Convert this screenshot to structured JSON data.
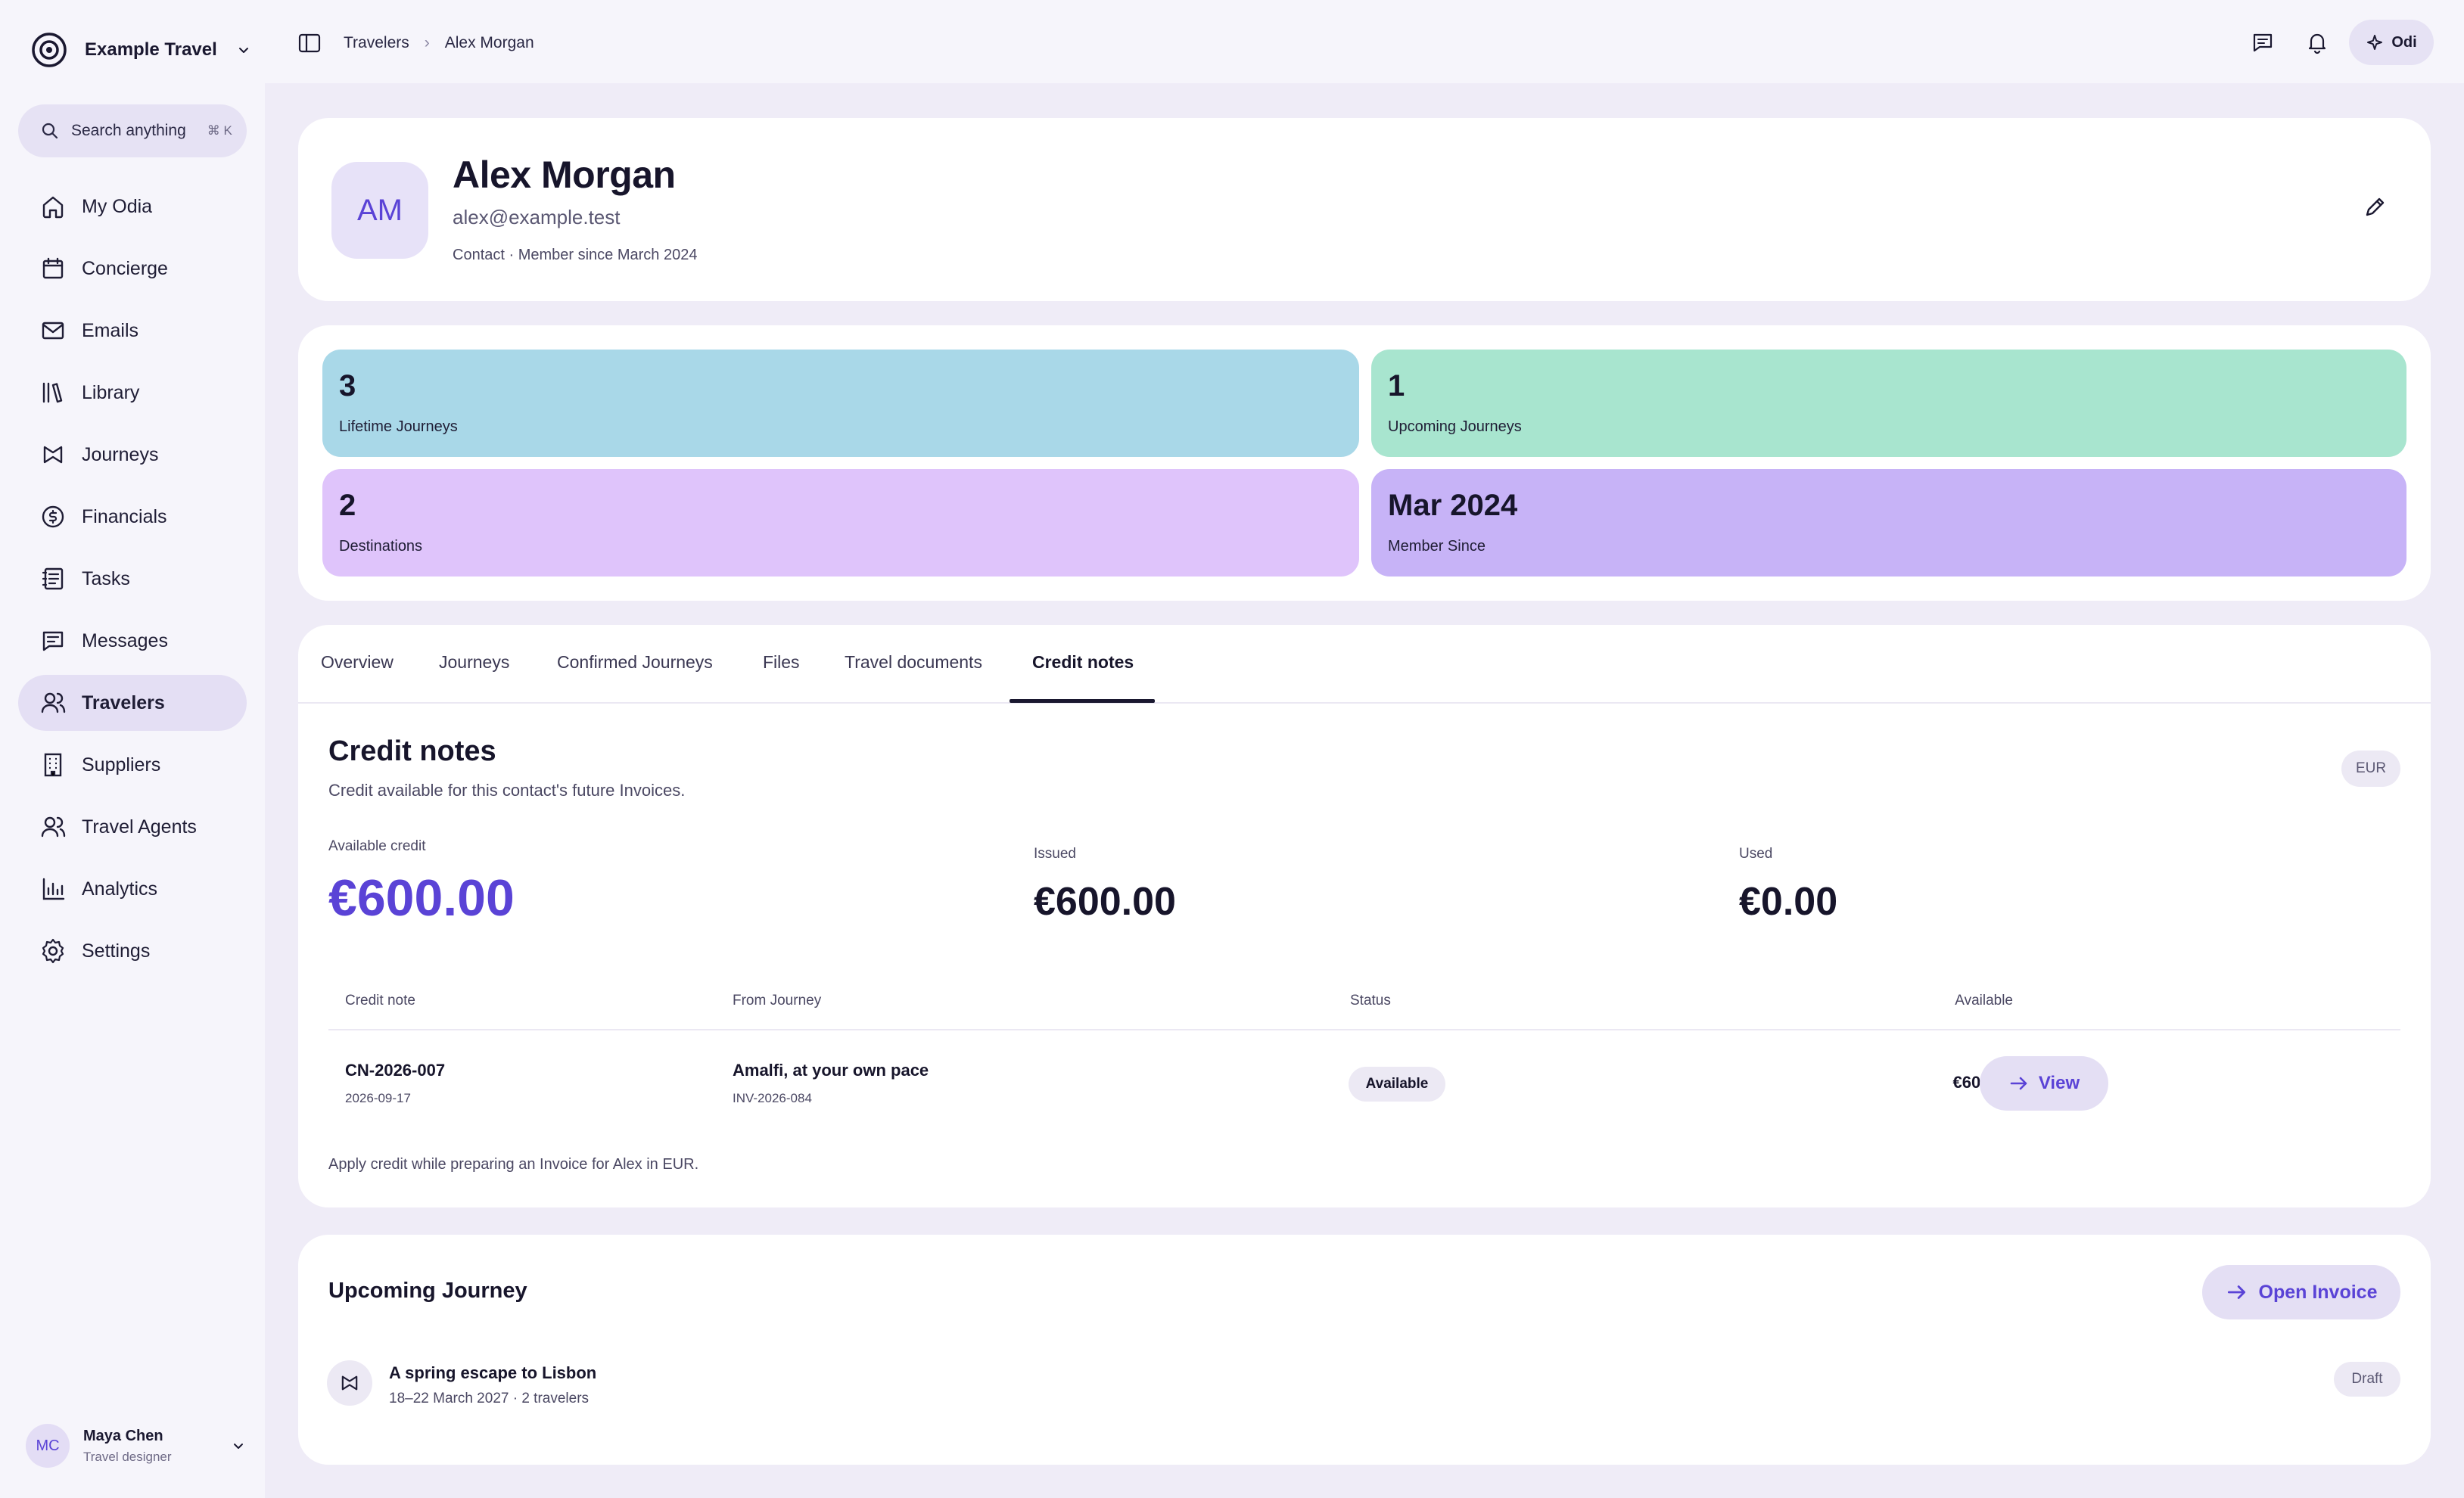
{
  "brand": {
    "name": "Example Travel"
  },
  "search": {
    "placeholder": "Search anything",
    "shortcut": "⌘ K"
  },
  "sidebar": {
    "items": [
      {
        "label": "My Odia",
        "icon": "home-icon"
      },
      {
        "label": "Concierge",
        "icon": "calendar-icon"
      },
      {
        "label": "Emails",
        "icon": "mail-icon"
      },
      {
        "label": "Library",
        "icon": "library-icon"
      },
      {
        "label": "Journeys",
        "icon": "journeys-icon"
      },
      {
        "label": "Financials",
        "icon": "dollar-icon"
      },
      {
        "label": "Tasks",
        "icon": "tasks-icon"
      },
      {
        "label": "Messages",
        "icon": "messages-icon"
      },
      {
        "label": "Travelers",
        "icon": "users-icon",
        "active": true
      },
      {
        "label": "Suppliers",
        "icon": "building-icon"
      },
      {
        "label": "Travel Agents",
        "icon": "users-icon"
      },
      {
        "label": "Analytics",
        "icon": "chart-icon"
      },
      {
        "label": "Settings",
        "icon": "gear-icon"
      }
    ]
  },
  "user": {
    "initials": "MC",
    "name": "Maya Chen",
    "role": "Travel designer"
  },
  "breadcrumb": {
    "parent": "Travelers",
    "current": "Alex Morgan"
  },
  "topbar": {
    "assistant_label": "Odi"
  },
  "profile": {
    "initials": "AM",
    "name": "Alex Morgan",
    "email": "alex@example.test",
    "meta": "Contact · Member since March 2024"
  },
  "stats": [
    {
      "value": "3",
      "label": "Lifetime Journeys",
      "color": "#a9d8e8"
    },
    {
      "value": "1",
      "label": "Upcoming Journeys",
      "color": "#a8e5cf"
    },
    {
      "value": "2",
      "label": "Destinations",
      "color": "#dfc4fb"
    },
    {
      "value": "Mar 2024",
      "label": "Member Since",
      "color": "#c7b3f7"
    }
  ],
  "tabs": [
    {
      "label": "Overview"
    },
    {
      "label": "Journeys"
    },
    {
      "label": "Confirmed Journeys"
    },
    {
      "label": "Files"
    },
    {
      "label": "Travel documents"
    },
    {
      "label": "Credit notes",
      "active": true
    }
  ],
  "credit_notes": {
    "title": "Credit notes",
    "subtitle": "Credit available for this contact's future Invoices.",
    "currency": "EUR",
    "available_label": "Available credit",
    "available_value": "€600.00",
    "issued_label": "Issued",
    "issued_value": "€600.00",
    "used_label": "Used",
    "used_value": "€0.00",
    "columns": [
      "Credit note",
      "From Journey",
      "Status",
      "Available"
    ],
    "rows": [
      {
        "number": "CN-2026-007",
        "date": "2026-09-17",
        "journey": "Amalfi, at your own pace",
        "invoice": "INV-2026-084",
        "status": "Available",
        "available": "€600.00",
        "action": "View"
      }
    ],
    "footnote": "Apply credit while preparing an Invoice for Alex in EUR."
  },
  "upcoming": {
    "title": "Upcoming Journey",
    "button": "Open Invoice",
    "journey_title": "A spring escape to Lisbon",
    "journey_sub": "18–22 March 2027 · 2 travelers",
    "status": "Draft"
  },
  "colors": {
    "accent": "#5a43d6",
    "background": "#efecf7",
    "sidebar": "#f6f5fb"
  }
}
